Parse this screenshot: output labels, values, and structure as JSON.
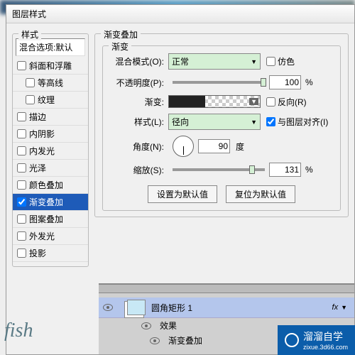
{
  "dialog_title": "图层样式",
  "sidebar": {
    "label": "样式",
    "blend_default": "混合选项:默认",
    "items": [
      {
        "label": "斜面和浮雕",
        "checked": false,
        "selected": false
      },
      {
        "label": "等高线",
        "checked": false,
        "selected": false,
        "indent": true
      },
      {
        "label": "纹理",
        "checked": false,
        "selected": false,
        "indent": true
      },
      {
        "label": "描边",
        "checked": false,
        "selected": false
      },
      {
        "label": "内阴影",
        "checked": false,
        "selected": false
      },
      {
        "label": "内发光",
        "checked": false,
        "selected": false
      },
      {
        "label": "光泽",
        "checked": false,
        "selected": false
      },
      {
        "label": "颜色叠加",
        "checked": false,
        "selected": false
      },
      {
        "label": "渐变叠加",
        "checked": true,
        "selected": true
      },
      {
        "label": "图案叠加",
        "checked": false,
        "selected": false
      },
      {
        "label": "外发光",
        "checked": false,
        "selected": false
      },
      {
        "label": "投影",
        "checked": false,
        "selected": false
      }
    ]
  },
  "main": {
    "section_title": "渐变叠加",
    "gradient_group": "渐变",
    "blend_mode_label": "混合模式(O):",
    "blend_mode_value": "正常",
    "dither_label": "仿色",
    "opacity_label": "不透明度(P):",
    "opacity_value": "100",
    "opacity_unit": "%",
    "gradient_label": "渐变:",
    "reverse_label": "反向(R)",
    "style_label": "样式(L):",
    "style_value": "径向",
    "align_label": "与图层对齐(I)",
    "angle_label": "角度(N):",
    "angle_value": "90",
    "angle_unit": "度",
    "scale_label": "缩放(S):",
    "scale_value": "131",
    "scale_unit": "%",
    "set_default_btn": "设置为默认值",
    "reset_default_btn": "复位为默认值"
  },
  "layers": {
    "layer_name": "圆角矩形 1",
    "fx_label": "fx",
    "effects_label": "效果",
    "gradient_overlay_label": "渐变叠加"
  },
  "watermarks": {
    "fish": "fish",
    "zixue_text": "溜溜自学",
    "zixue_url": "zixue.3d66.com"
  }
}
